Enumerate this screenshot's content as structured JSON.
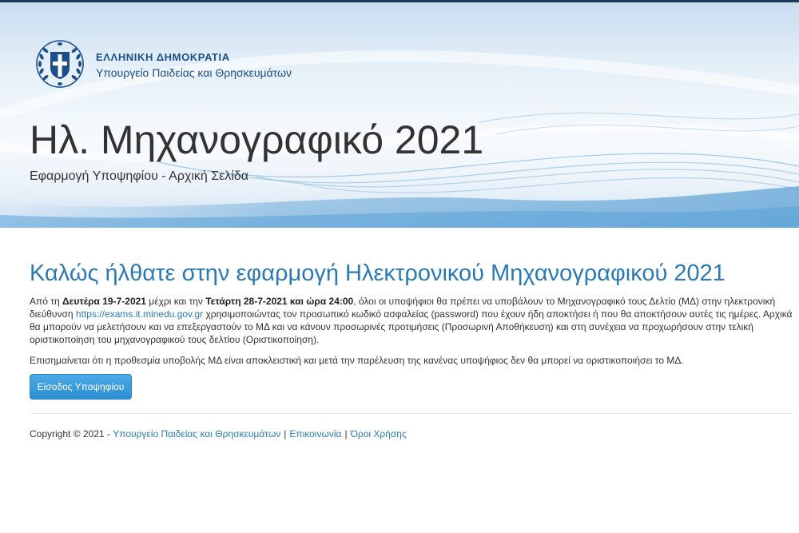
{
  "header": {
    "org_name": "ΕΛΛΗΝΙΚΗ ΔΗΜΟΚΡΑΤΙΑ",
    "ministry": "Υπουργείο Παιδείας και Θρησκευμάτων",
    "title": "Ηλ. Μηχανογραφικό 2021",
    "subtitle": "Εφαρμογή Υποψηφίου - Αρχική Σελίδα",
    "logo_icon": "greek-coat-of-arms-icon"
  },
  "main": {
    "welcome": "Καλώς ήλθατε στην εφαρμογή Ηλεκτρονικού Μηχανογραφικού 2021",
    "intro": {
      "p1": "Από τη ",
      "b1": "Δευτέρα 19-7-2021",
      "p2": " μέχρι και την ",
      "b2": "Τετάρτη 28-7-2021 και ώρα 24:00",
      "p3": ", όλοι οι υποψήφιοι θα πρέπει να υποβάλουν το Μηχανογραφικό τους Δελτίο (ΜΔ) στην ηλεκτρονική διεύθυνση ",
      "link": "https://exams.it.minedu.gov.gr",
      "p4": " χρησιμοποιώντας τον προσωπικό κωδικό ασφαλείας (password) που έχουν ήδη αποκτήσει ή που θα αποκτήσουν αυτές τις ημέρες. Αρχικά θα μπορούν να μελετήσουν και να επεξεργαστούν το ΜΔ και να κάνουν προσωρινές προτιμήσεις (Προσωρινή Αποθήκευση) και στη συνέχεια να προχωρήσουν στην τελική οριστικοποίηση του μηχανογραφικού τους δελτίου (Οριστικοποίηση)."
    },
    "notice": "Επισημαίνεται ότι η προθεσμία υποβολής ΜΔ είναι αποκλειστική και μετά την παρέλευση της κανένας υποψήφιος δεν θα μπορεί να οριστικοποιήσει το ΜΔ.",
    "login_button": "Είσοδος Υποψηφίου"
  },
  "footer": {
    "copyright": "Copyright © 2021 -",
    "ministry_link": "Υπουργείο Παιδείας και Θρησκευμάτων",
    "sep": "|",
    "contact_link": "Επικοινωνία",
    "terms_link": "Όροι Χρήσης"
  },
  "colors": {
    "accent": "#2a7ab8",
    "button": "#2c8fd1",
    "logo_blue": "#1b4f8c"
  }
}
